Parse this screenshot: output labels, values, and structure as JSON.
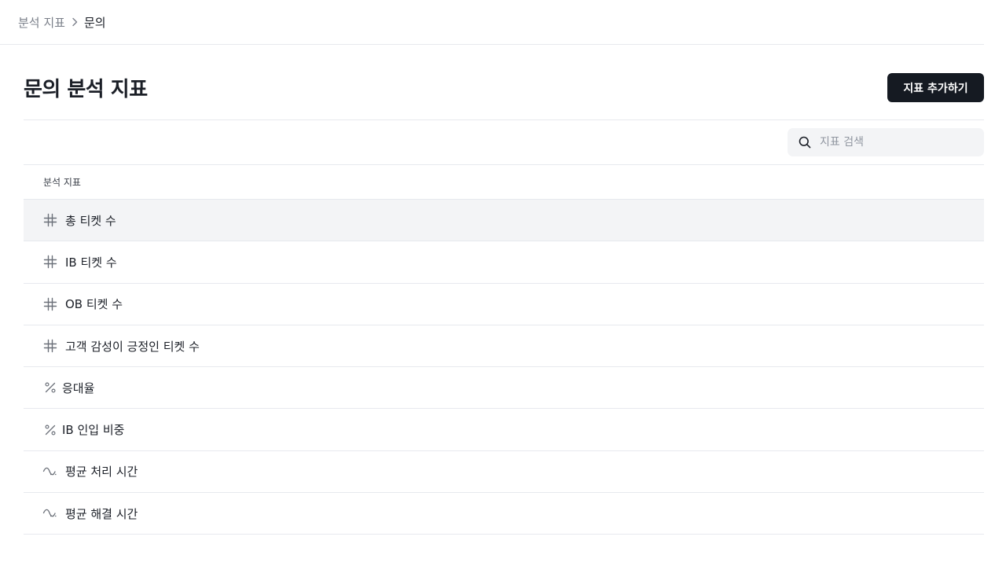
{
  "breadcrumb": {
    "parent": "분석 지표",
    "current": "문의"
  },
  "header": {
    "title": "문의 분석 지표",
    "add_button_label": "지표 추가하기"
  },
  "search": {
    "placeholder": "지표 검색",
    "value": "",
    "icon": "search-icon"
  },
  "table": {
    "column_header": "분석 지표",
    "rows": [
      {
        "label": "총 티켓 수",
        "icon": "hash-icon",
        "selected": true
      },
      {
        "label": "IB 티켓 수",
        "icon": "hash-icon",
        "selected": false
      },
      {
        "label": "OB 티켓 수",
        "icon": "hash-icon",
        "selected": false
      },
      {
        "label": "고객 감성이 긍정인 티켓 수",
        "icon": "hash-icon",
        "selected": false
      },
      {
        "label": "응대율",
        "icon": "percent-icon",
        "selected": false
      },
      {
        "label": "IB 인입 비중",
        "icon": "percent-icon",
        "selected": false
      },
      {
        "label": "평균 처리 시간",
        "icon": "average-icon",
        "selected": false
      },
      {
        "label": "평균 해결 시간",
        "icon": "average-icon",
        "selected": false
      }
    ]
  },
  "colors": {
    "primary_button": "#151a22",
    "selected_row": "#f3f4f6",
    "divider": "#e7e9ee"
  }
}
